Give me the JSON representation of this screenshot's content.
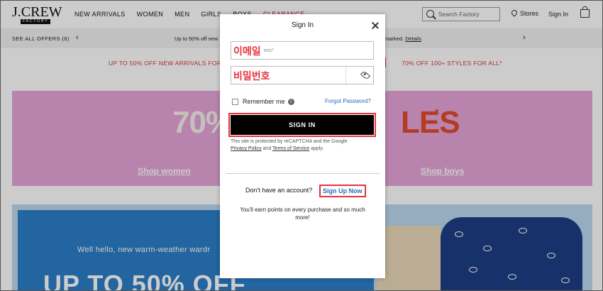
{
  "header": {
    "logo": "J.CREW",
    "logo_sub": "FACTORY",
    "nav": [
      "NEW ARRIVALS",
      "WOMEN",
      "MEN",
      "GIRLS",
      "BOYS",
      "CLEARANCE"
    ],
    "search_placeholder": "Search Factory",
    "stores": "Stores",
    "sign_in": "Sign In"
  },
  "offers": {
    "see_all": "SEE ALL OFFERS (6)",
    "msg_left": "Up to 50% off new",
    "msg_right": "marked.",
    "details": "Details"
  },
  "promo": {
    "left": "UP TO 50% OFF NEW ARRIVALS FOR T",
    "right": "70% OFF 100+ STYLES FOR ALL*"
  },
  "hero": {
    "left_big": "70%",
    "right_big": "LES",
    "star": "*",
    "shop_women": "Shop women",
    "shop_boys": "Shop boys"
  },
  "banner2": {
    "line1": "Well hello, new warm-weather wardr",
    "line2": "UP TO 50% OFF"
  },
  "modal": {
    "title": "Sign In",
    "email_label": "이메일",
    "email_placeholder": "ess*",
    "password_label": "비밀번호",
    "remember_me": "Remember me",
    "info": "i",
    "forgot_password": "Forgot Password?",
    "sign_in_button": "SIGN IN",
    "recaptcha_text": "This site is protected by reCAPTCHA and the Google",
    "privacy_policy": "Privacy Policy",
    "and": "and",
    "terms": "Terms of Service",
    "apply": "apply.",
    "no_account": "Don't have an account?",
    "sign_up": "Sign Up Now",
    "earn_points": "You'll earn points on every purchase and so much more!"
  },
  "colors": {
    "accent_red": "#e8333a",
    "link_blue": "#2a6ab8",
    "hero_pink": "#e7a6d9"
  }
}
